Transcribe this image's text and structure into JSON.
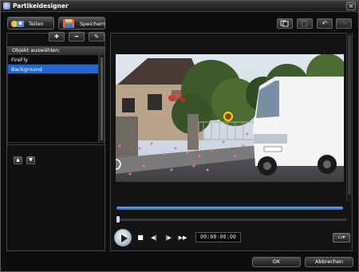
{
  "window": {
    "title": "Partikeldesigner",
    "close_glyph": "×"
  },
  "toolbar": {
    "share_label": "Teilen",
    "save_label": "Speichern",
    "icons": [
      "copy-icon",
      "paste-icon",
      "undo-icon",
      "redo-icon"
    ],
    "undo_glyph": "↶",
    "redo_glyph": "↷"
  },
  "objects": {
    "add_glyph": "✚",
    "remove_glyph": "━",
    "edit_glyph": "✎",
    "header": "Objekt auswählen:",
    "items": [
      {
        "label": "FireFly",
        "selected": false
      },
      {
        "label": "Background",
        "selected": true
      }
    ],
    "up_glyph": "▲",
    "down_glyph": "▼"
  },
  "player": {
    "timecode": "00:00:00:00",
    "progress_fraction": 1.0,
    "scrub_fraction": 0.0,
    "stop_glyph": "■",
    "prev_frame_glyph": "◀|",
    "next_frame_glyph": "|▶",
    "fast_forward_glyph": "▶▶",
    "aspect_glyph": "▭▾"
  },
  "footer": {
    "ok_label": "OK",
    "cancel_label": "Abbrechen"
  },
  "colors": {
    "accent": "#2367d2",
    "progress": "#2a64c8",
    "background": "#0d0d0d"
  }
}
